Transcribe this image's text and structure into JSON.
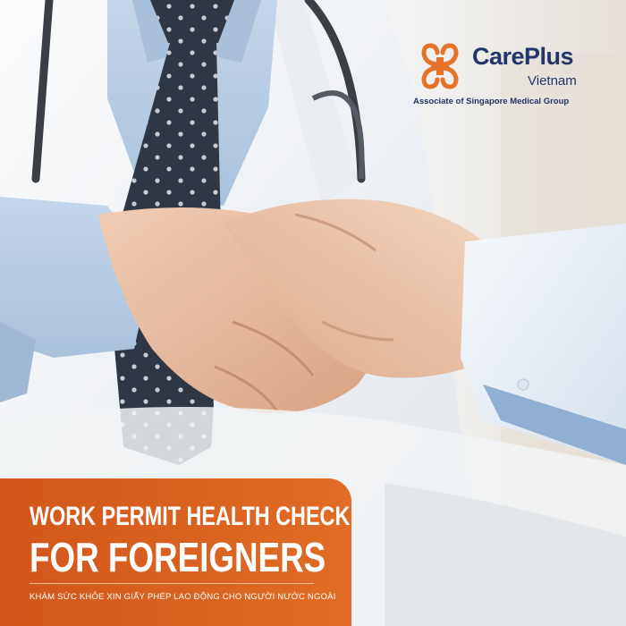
{
  "logo": {
    "brand_name": "CarePlus",
    "brand_sub": "Vietnam",
    "tagline": "Associate of Singapore Medical Group"
  },
  "banner": {
    "headline_1": "WORK PERMIT HEALTH CHECK",
    "headline_2": "FOR FOREIGNERS",
    "subline": "KHÁM SỨC KHỎE XIN GIẤY PHÉP LAO ĐỘNG CHO NGƯỜI NƯỚC NGOÀI"
  },
  "colors": {
    "banner_orange": "#d9601f",
    "brand_navy": "#23356b",
    "logo_orange": "#e5732a",
    "tie_navy": "#2c3442",
    "shirt_blue": "#b9cfe6"
  },
  "icons": [
    "careplus-logo-icon"
  ]
}
